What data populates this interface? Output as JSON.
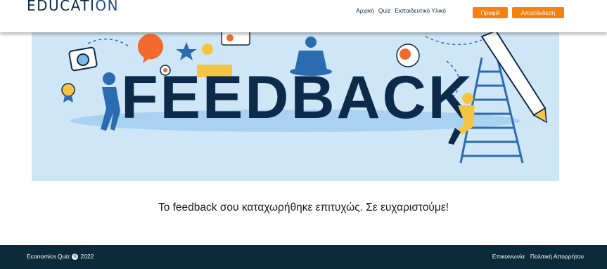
{
  "header": {
    "logo_text": "EDUCATI",
    "logo_o": "ON",
    "nav": [
      {
        "label": "Αρχική"
      },
      {
        "label": "Quiz"
      },
      {
        "label": "Εκπαιδευτικό Υλικό"
      }
    ],
    "profile_label": "Προφίλ",
    "logout_label": "Αποσύνδεση"
  },
  "banner": {
    "word": "FEEDBACK",
    "colors": {
      "background": "#cfe6f7",
      "word": "#0d2a4a",
      "accent": "#f7810e"
    }
  },
  "message": "Το feedback σου καταχωρήθηκε επιτυχώς. Σε ευχαριστούμε!",
  "footer": {
    "brand": "Economics Quiz",
    "copyright_symbol": "©",
    "year": "2022",
    "links": [
      {
        "label": "Επικοινωνία"
      },
      {
        "label": "Πολιτική Απορρήτου"
      }
    ]
  }
}
